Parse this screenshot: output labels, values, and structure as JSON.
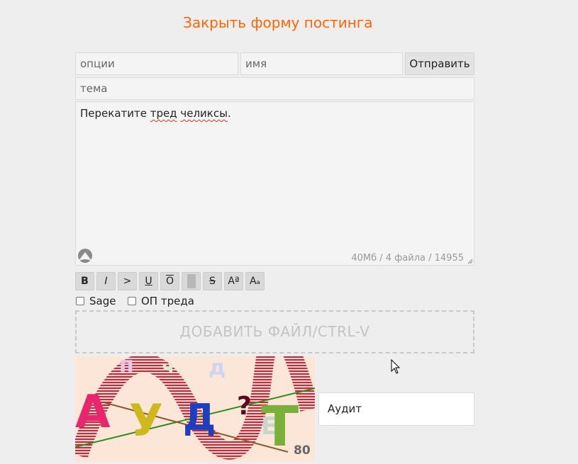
{
  "form": {
    "close_label": "Закрыть форму постинга",
    "options_placeholder": "опции",
    "name_placeholder": "имя",
    "submit_label": "Отправить",
    "subject_placeholder": "тема",
    "message_before": "Перекатите ",
    "message_word1": "тред",
    "message_space": " ",
    "message_word2": "челиксы",
    "message_after": ".",
    "counter": "40Мб / 4 файла / 14955"
  },
  "format_buttons": [
    {
      "label": "B"
    },
    {
      "label": "I"
    },
    {
      "label": ">"
    },
    {
      "label": "U"
    },
    {
      "label": "O"
    },
    {
      "label": ""
    },
    {
      "label": "S"
    },
    {
      "label": "Aª"
    },
    {
      "label": "Aₐ"
    }
  ],
  "checkboxes": {
    "sage_label": "Sage",
    "op_label": "ОП треда"
  },
  "dropzone": {
    "label": "ДОБАВИТЬ ФАЙЛ/CTRL-V"
  },
  "captcha": {
    "image_text": "АУДТ",
    "corner_number": "80",
    "input_value": "Аудит"
  },
  "colors": {
    "accent": "#ff6600",
    "background": "#eeeeee"
  }
}
